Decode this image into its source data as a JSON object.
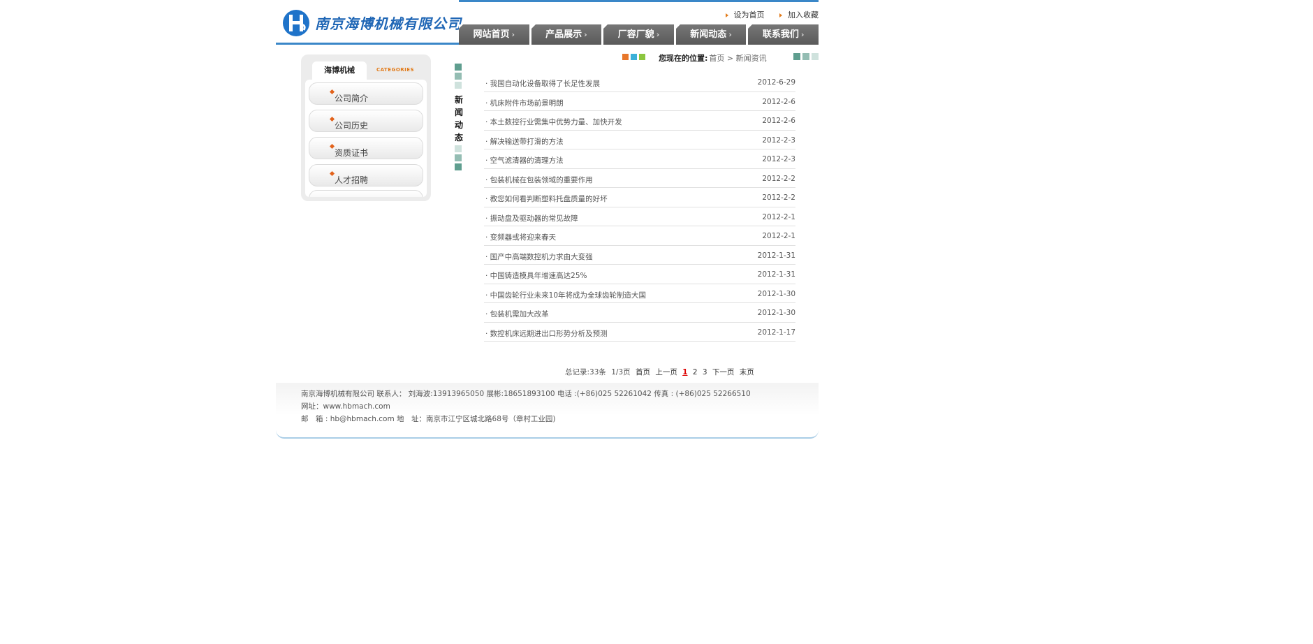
{
  "header": {
    "company_name": "南京海博机械有限公司",
    "quick_links": [
      "设为首页",
      "加入收藏"
    ]
  },
  "nav": [
    "网站首页",
    "产品展示",
    "厂容厂貌",
    "新闻动态",
    "联系我们"
  ],
  "sidebar": {
    "tab_label": "海博机械",
    "tab_sub": "CATEGORIES",
    "items": [
      "公司简介",
      "公司历史",
      "资质证书",
      "人才招聘"
    ]
  },
  "section_title": [
    "新",
    "闻",
    "动",
    "态"
  ],
  "location": {
    "label": "您现在的位置:",
    "path": "首页 > 新闻资讯"
  },
  "news": [
    {
      "title": "· 我国自动化设备取得了长足性发展",
      "date": "2012-6-29"
    },
    {
      "title": "· 机床附件市场前景明朗",
      "date": "2012-2-6"
    },
    {
      "title": "· 本土数控行业需集中优势力量、加快开发",
      "date": "2012-2-6"
    },
    {
      "title": "· 解决输送带打滑的方法",
      "date": "2012-2-3"
    },
    {
      "title": "· 空气滤清器的清理方法",
      "date": "2012-2-3"
    },
    {
      "title": "· 包装机械在包装领域的重要作用",
      "date": "2012-2-2"
    },
    {
      "title": "· 教您如何看判断塑料托盘质量的好坏",
      "date": "2012-2-2"
    },
    {
      "title": "· 振动盘及驱动器的常见故障",
      "date": "2012-2-1"
    },
    {
      "title": "· 变频器或将迎来春天",
      "date": "2012-2-1"
    },
    {
      "title": "· 国产中高端数控机力求由大变强",
      "date": "2012-1-31"
    },
    {
      "title": "· 中国铸造模具年增速高达25%",
      "date": "2012-1-31"
    },
    {
      "title": "· 中国齿轮行业未来10年将成为全球齿轮制造大国",
      "date": "2012-1-30"
    },
    {
      "title": "· 包装机需加大改革",
      "date": "2012-1-30"
    },
    {
      "title": "· 数控机床远期进出口形势分析及预测",
      "date": "2012-1-17"
    }
  ],
  "pager": {
    "total": "总记录:33条",
    "pages": "1/3页",
    "first": "首页",
    "prev": "上一页",
    "current": "1",
    "p2": "2",
    "p3": "3",
    "next": "下一页",
    "last": "末页"
  },
  "footer": {
    "line1": "南京海博机械有限公司 联系人： 刘海波:13913965050 展彬:18651893100 电话 :(+86)025 52261042 传真 : (+86)025 52266510",
    "line2": "网址：www.hbmach.com",
    "line3": "邮　箱 : hb@hbmach.com 地　址：南京市江宁区城北路68号（章村工业园)"
  },
  "colors": {
    "accent_blue": "#3a87c8",
    "nav_gray": "#666666",
    "bullet_orange": "#e2621b",
    "teal_square": "#5f9e8f"
  }
}
